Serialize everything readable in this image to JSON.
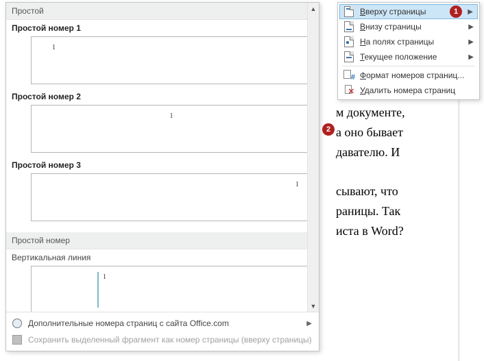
{
  "doc_text": "м документе,\nа оно бывает\nдавателю. И\n\nсывают, что\nраницы. Так\nиста в Word?",
  "gallery": {
    "section_simple": "Простой",
    "item1": "Простой номер 1",
    "item2": "Простой номер 2",
    "item3": "Простой номер 3",
    "section_plain": "Простой номер",
    "item4": "Вертикальная линия",
    "sample_num": "1",
    "footer_more": "Дополнительные номера страниц с сайта Office.com",
    "footer_save": "Сохранить выделенный фрагмент как номер страницы (вверху страницы)"
  },
  "menu": {
    "top": "Вверху страницы",
    "bottom": "Внизу страницы",
    "margins": "На полях страницы",
    "current": "Текущее положение",
    "format": "Формат номеров страниц...",
    "remove": "Удалить номера страниц"
  },
  "badges": {
    "b1": "1",
    "b2": "2"
  }
}
